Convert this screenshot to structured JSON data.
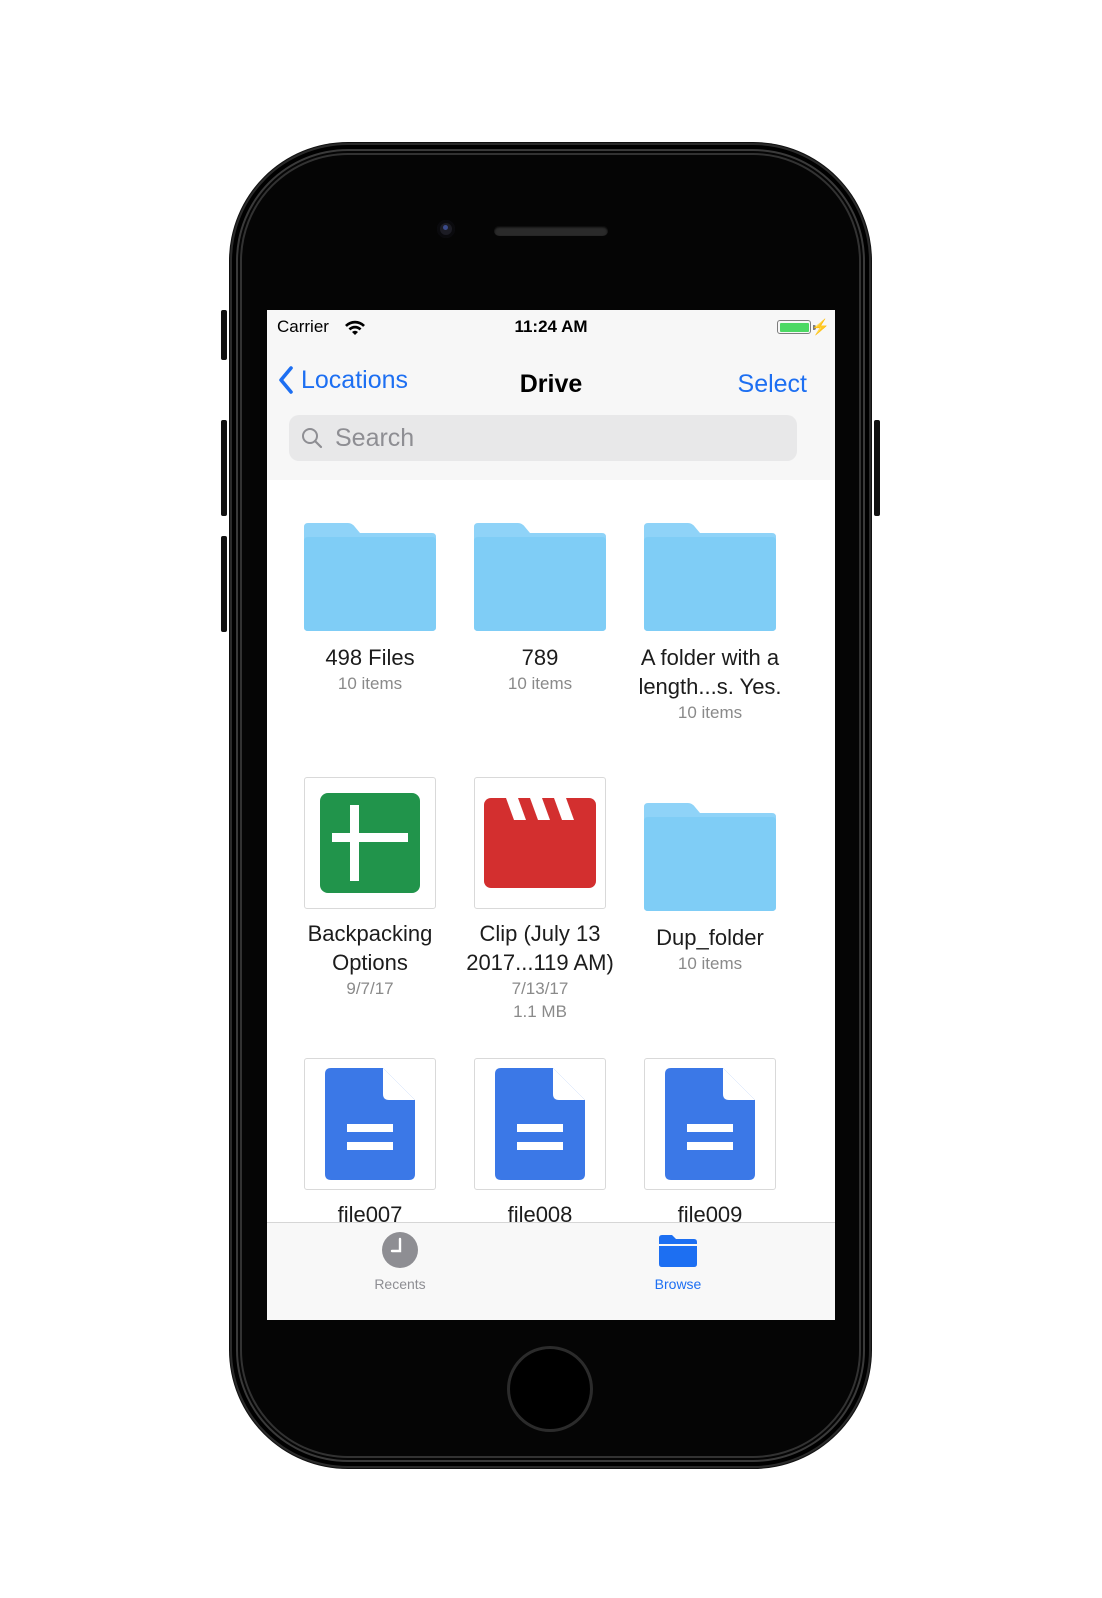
{
  "status_bar": {
    "carrier": "Carrier",
    "time": "11:24 AM"
  },
  "nav": {
    "back_label": "Locations",
    "title": "Drive",
    "select_label": "Select"
  },
  "search": {
    "placeholder": "Search"
  },
  "items": [
    {
      "name": "498 Files",
      "meta1": "10 items",
      "meta2": "",
      "kind": "folder"
    },
    {
      "name": "789",
      "meta1": "10 items",
      "meta2": "",
      "kind": "folder"
    },
    {
      "name": "A folder with a length...s. Yes.",
      "meta1": "10 items",
      "meta2": "",
      "kind": "folder"
    },
    {
      "name": "Backpacking Options",
      "meta1": "9/7/17",
      "meta2": "",
      "kind": "sheet"
    },
    {
      "name": "Clip (July 13 2017...119 AM)",
      "meta1": "7/13/17",
      "meta2": "1.1 MB",
      "kind": "video"
    },
    {
      "name": "Dup_folder",
      "meta1": "10 items",
      "meta2": "",
      "kind": "folder"
    },
    {
      "name": "file007",
      "meta1": "",
      "meta2": "",
      "kind": "doc"
    },
    {
      "name": "file008",
      "meta1": "",
      "meta2": "",
      "kind": "doc"
    },
    {
      "name": "file009",
      "meta1": "",
      "meta2": "",
      "kind": "doc"
    }
  ],
  "tabs": {
    "recents": "Recents",
    "browse": "Browse"
  },
  "colors": {
    "accent": "#1d6ff2",
    "folder": "#7fcdf6",
    "sheet": "#21944b",
    "video": "#d32f2f",
    "doc": "#3b78e7",
    "battery": "#4cd964"
  },
  "icons": {
    "back": "chevron-left-icon",
    "search": "search-icon",
    "recents": "clock-icon",
    "browse": "folder-icon"
  }
}
